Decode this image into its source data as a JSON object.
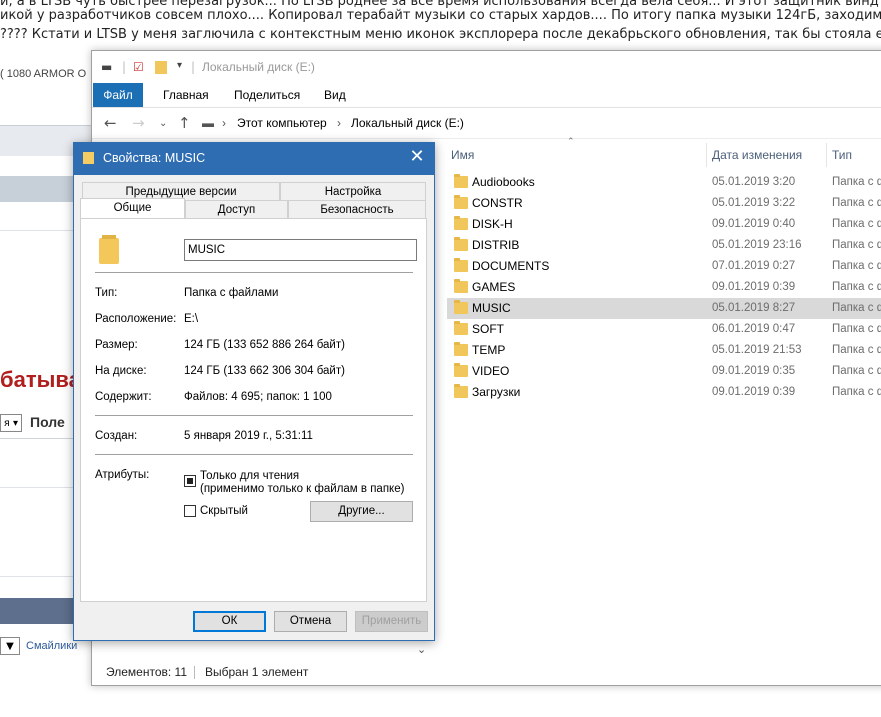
{
  "background_page": {
    "line1": "й, а в LTSB чуть быстрее перезагрузок... По LTSB роднее за все время использования всегда вела себя... И этот защитник винд",
    "line2": "икой у разработчиков совсем плохо.... Копировал терабайт музыки со старых хардов.... По итогу папка музыки 124гБ, заходим в",
    "line3": "???? Кстати и LTSB у меня заглючила с контекстным меню иконок эксплорера после декабрьского обновления, так бы стояла ещ",
    "gpu": "( 1080 ARMOR O",
    "heading": "батыва",
    "select_arrow": "я ▾",
    "field_label": "Поле",
    "select2_arrow": "▼",
    "link": "Смайлики"
  },
  "explorer": {
    "title": "Локальный диск (E:)",
    "ribbon_tabs": [
      "Файл",
      "Главная",
      "Поделиться",
      "Вид"
    ],
    "address": {
      "part1": "Этот компьютер",
      "part2": "Локальный диск (E:)"
    },
    "columns": {
      "name": "Имя",
      "date": "Дата изменения",
      "type": "Тип"
    },
    "files": [
      {
        "name": "Audiobooks",
        "date": "05.01.2019 3:20",
        "type": "Папка с ф"
      },
      {
        "name": "CONSTR",
        "date": "05.01.2019 3:22",
        "type": "Папка с ф"
      },
      {
        "name": "DISK-H",
        "date": "09.01.2019 0:40",
        "type": "Папка с ф"
      },
      {
        "name": "DISTRIB",
        "date": "05.01.2019 23:16",
        "type": "Папка с ф"
      },
      {
        "name": "DOCUMENTS",
        "date": "07.01.2019 0:27",
        "type": "Папка с ф"
      },
      {
        "name": "GAMES",
        "date": "09.01.2019 0:39",
        "type": "Папка с ф"
      },
      {
        "name": "MUSIC",
        "date": "05.01.2019 8:27",
        "type": "Папка с ф"
      },
      {
        "name": "SOFT",
        "date": "06.01.2019 0:47",
        "type": "Папка с ф"
      },
      {
        "name": "TEMP",
        "date": "05.01.2019 21:53",
        "type": "Папка с ф"
      },
      {
        "name": "VIDEO",
        "date": "09.01.2019 0:35",
        "type": "Папка с ф"
      },
      {
        "name": "Загрузки",
        "date": "09.01.2019 0:39",
        "type": "Папка с ф"
      }
    ],
    "selected_index": 6,
    "status_count": "Элементов: 11",
    "status_selected": "Выбран 1 элемент"
  },
  "dialog": {
    "title": "Свойства: MUSIC",
    "tabs_back": [
      "Предыдущие версии",
      "Настройка"
    ],
    "tabs_front": [
      "Общие",
      "Доступ",
      "Безопасность"
    ],
    "folder_name": "MUSIC",
    "props": {
      "type_label": "Тип:",
      "type_value": "Папка с файлами",
      "location_label": "Расположение:",
      "location_value": "E:\\",
      "size_label": "Размер:",
      "size_value": "124 ГБ (133 652 886 264 байт)",
      "disk_label": "На диске:",
      "disk_value": "124 ГБ (133 662 306 304 байт)",
      "contains_label": "Содержит:",
      "contains_value": "Файлов: 4 695; папок: 1 100",
      "created_label": "Создан:",
      "created_value": "5 января 2019 г., 5:31:11",
      "attrs_label": "Атрибуты:"
    },
    "readonly_label": "Только для чтения",
    "readonly_note": "(применимо только к файлам в папке)",
    "hidden_label": "Скрытый",
    "other_button": "Другие...",
    "ok": "ОК",
    "cancel": "Отмена",
    "apply": "Применить"
  },
  "colors": {
    "dialog_title_bg": "#2f6db3",
    "ribbon_file_bg": "#1a6fb5",
    "selection": "#d9d9d9",
    "folder": "#f1c65a"
  }
}
